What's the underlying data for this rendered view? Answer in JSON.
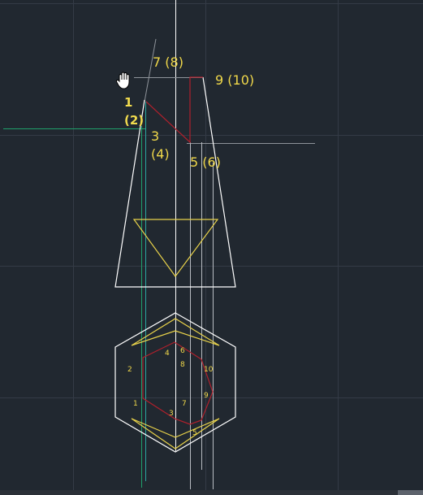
{
  "elevation_labels": {
    "l78": "7 (8)",
    "l910": "9 (10)",
    "l1": "1",
    "l2": "(2)",
    "l3": "3",
    "l4": "(4)",
    "l56": "5 (6)"
  },
  "plan_labels": {
    "p1": "1",
    "p2": "2",
    "p3": "3",
    "p4": "4",
    "p5": "5",
    "p6": "6",
    "p7": "7",
    "p8": "8",
    "p9": "9",
    "p10": "10"
  },
  "colors": {
    "background": "#212830",
    "grid": "#343b46",
    "outline": "#ffffff",
    "triangle": "#e8d24a",
    "section_line": "#b0202c",
    "label": "#f0d84a",
    "guide_green": "#1fa06a",
    "guide_teal": "#2aa7a0",
    "projection": "#b8bcc2"
  },
  "icons": {
    "cursor": "pan-hand-icon"
  }
}
